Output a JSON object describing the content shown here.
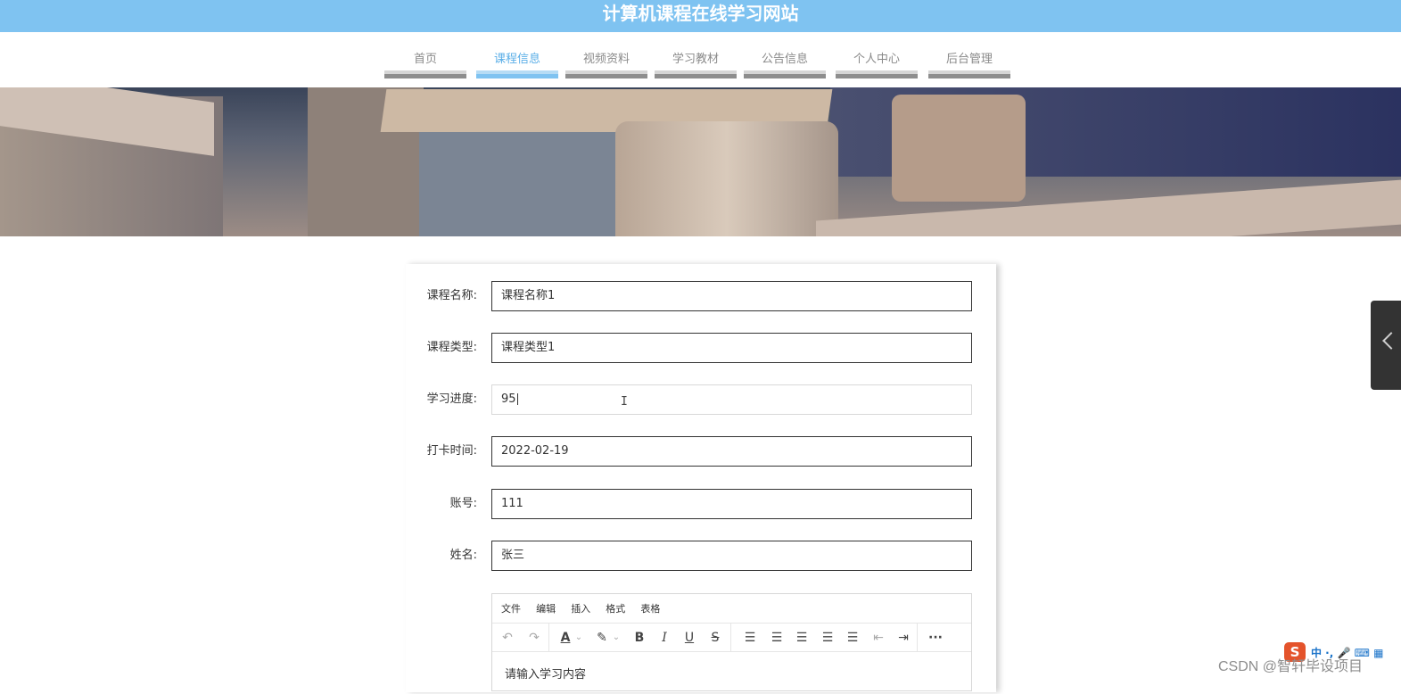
{
  "header": {
    "title": "计算机课程在线学习网站"
  },
  "nav": {
    "items": [
      {
        "label": "首页",
        "active": false
      },
      {
        "label": "课程信息",
        "active": true
      },
      {
        "label": "视频资料",
        "active": false
      },
      {
        "label": "学习教材",
        "active": false
      },
      {
        "label": "公告信息",
        "active": false
      },
      {
        "label": "个人中心",
        "active": false
      },
      {
        "label": "后台管理",
        "active": false
      }
    ]
  },
  "form": {
    "course_name": {
      "label": "课程名称:",
      "value": "课程名称1"
    },
    "course_type": {
      "label": "课程类型:",
      "value": "课程类型1"
    },
    "progress": {
      "label": "学习进度:",
      "value": "95"
    },
    "checkin_time": {
      "label": "打卡时间:",
      "value": "2022-02-19"
    },
    "account": {
      "label": "账号:",
      "value": "111"
    },
    "name": {
      "label": "姓名:",
      "value": "张三"
    }
  },
  "editor": {
    "menu": [
      "文件",
      "编辑",
      "插入",
      "格式",
      "表格"
    ],
    "placeholder": "请输入学习内容",
    "toolbar_icons": [
      "undo-icon",
      "redo-icon",
      "text-color-icon",
      "highlight-color-icon",
      "bold-icon",
      "italic-icon",
      "underline-icon",
      "strikethrough-icon",
      "line-height-icon",
      "align-left-icon",
      "align-center-icon",
      "align-right-icon",
      "align-justify-icon",
      "outdent-icon",
      "indent-icon",
      "more-icon"
    ]
  },
  "ime": {
    "logo": "S",
    "status": "中 ·, 🎤 ⌨ ▦"
  },
  "watermark": "CSDN @智轩毕设项目",
  "colors": {
    "header_bg": "#7fc3f1",
    "nav_active": "#5aaee7"
  }
}
